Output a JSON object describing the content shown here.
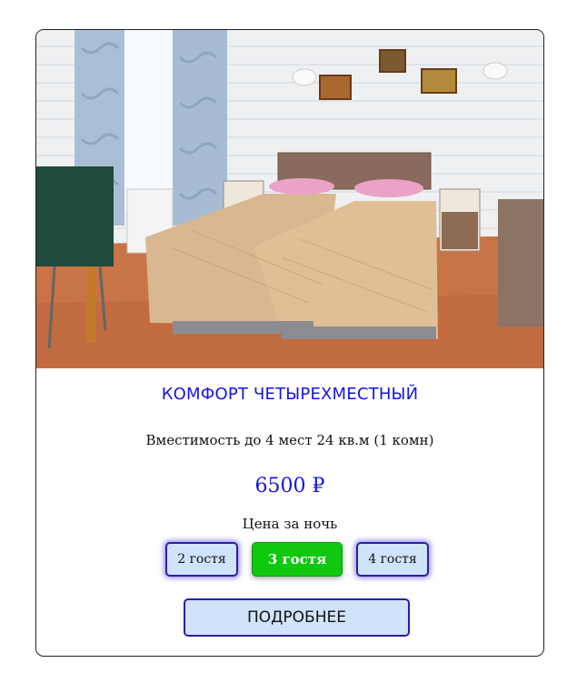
{
  "room": {
    "title": "КОМФОРТ ЧЕТЫРЕХМЕСТНЫЙ",
    "capacity": "Вместимость до 4 мест 24 кв.м (1 комн)",
    "price": "6500 ₽",
    "price_note": "Цена за ночь",
    "guest_options": [
      {
        "label": "2 гостя",
        "active": false
      },
      {
        "label": "3 гостя",
        "active": true
      },
      {
        "label": "4 гостя",
        "active": false
      }
    ],
    "details_label": "ПОДРОБНЕЕ"
  },
  "colors": {
    "accent": "#1515e6",
    "active_button": "#10c810",
    "button_fill": "#cfe3fb",
    "button_border": "#2a1fa8"
  }
}
